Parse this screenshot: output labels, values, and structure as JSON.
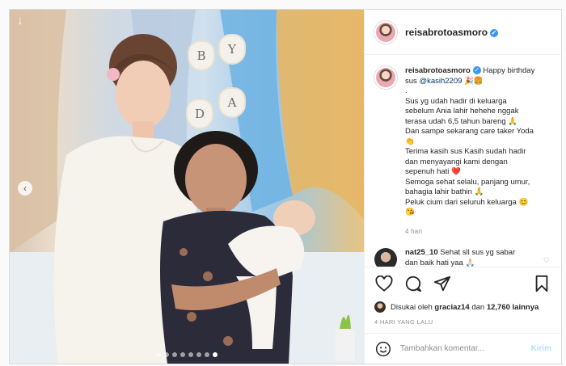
{
  "post": {
    "username": "reisabrotoasmoro",
    "verified": true
  },
  "photo": {
    "bunting_letters": [
      "B",
      "Y",
      "D",
      "A"
    ],
    "carousel_total": 8,
    "carousel_active": 7
  },
  "caption": {
    "username": "reisabrotoasmoro",
    "first": "Happy birthday",
    "first_cont": "sus ",
    "mention": "@kasih2209",
    "mention_suffix": " 🎉🍔",
    "lines": [
      ".",
      "Sus yg udah hadir di keluarga",
      "sebelum Ania lahir hehehe nggak",
      "terasa udah 6,5 tahun bareng 🙏",
      "Dan sampe sekarang care taker Yoda",
      "👏",
      "Terima kasih sus Kasih sudah hadir",
      "dan menyayangi kami dengan",
      "sepenuh hati ❤️",
      "Semoga sehat selalu, panjang umur,",
      "bahagia lahir bathin 🙏",
      "Peluk cium dari seluruh keluarga 😊",
      "😘"
    ],
    "time_ago": "4 hari"
  },
  "comments": [
    {
      "username": "nat25_10",
      "text": " Sehat sll sus yg sabar",
      "text2": "dan baik hati yaa 🙏🏻"
    }
  ],
  "likes": {
    "prefix": "Disukai oleh ",
    "user": "graciaz14",
    "middle": " dan ",
    "count": "12,760 lainnya"
  },
  "date_label": "4 HARI YANG LALU",
  "add_comment": {
    "placeholder": "Tambahkan komentar...",
    "post_label": "Kirim"
  },
  "icons": {
    "like": "heart-icon",
    "comment": "comment-icon",
    "share": "share-icon",
    "save": "bookmark-icon",
    "emoji": "smiley-icon"
  },
  "colors": {
    "verified": "#3897f0",
    "heart": "#ed4956",
    "post_button_disabled": "#b2dffc",
    "mention": "#00376b"
  }
}
